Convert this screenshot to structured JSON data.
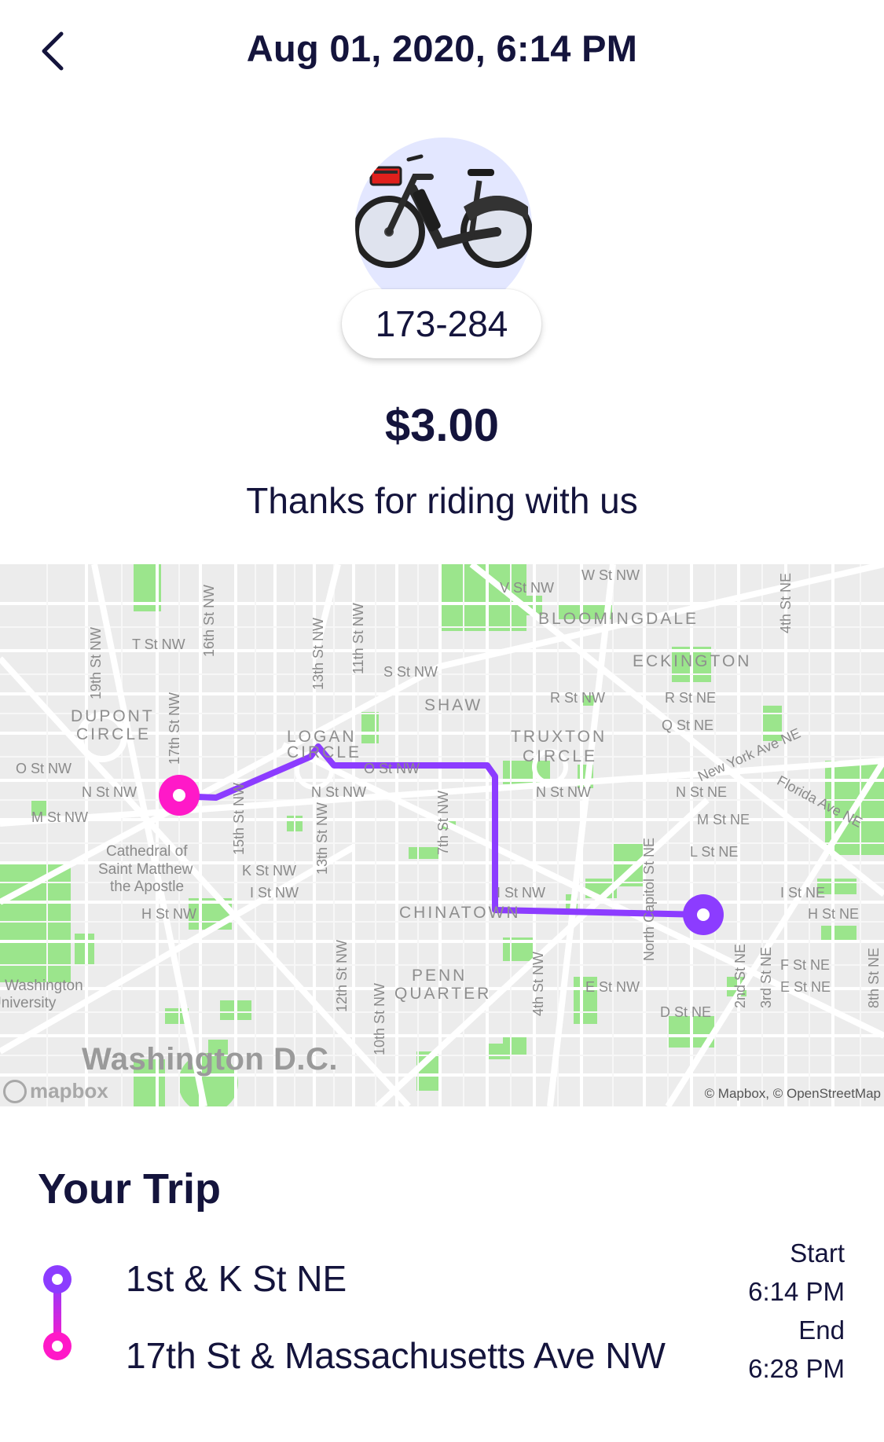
{
  "header": {
    "title": "Aug 01, 2020, 6:14 PM"
  },
  "bike": {
    "id": "173-284"
  },
  "receipt": {
    "price": "$3.00",
    "message": "Thanks for riding with us"
  },
  "map": {
    "districts": [
      "BLOOMINGDALE",
      "ECKINGTON",
      "SHAW",
      "TRUXTON",
      "CIRCLE",
      "DUPONT",
      "CIRCLE",
      "LOGAN",
      "CIRCLE",
      "CHINATOWN",
      "PENN",
      "QUARTER"
    ],
    "streets": [
      "T St NW",
      "S St NW",
      "R St NW",
      "R St NE",
      "Q St NE",
      "O St NW",
      "O St NW",
      "N St NW",
      "N St NW",
      "N St NW",
      "N St NE",
      "M St NW",
      "M St NE",
      "L St NE",
      "K St NW",
      "I St NW",
      "I St NW",
      "I St NE",
      "H St NW",
      "H St NE",
      "F St NE",
      "E St NE",
      "E St NW",
      "D St NE",
      "W St NW",
      "V St NW",
      "New York Ave NE",
      "Florida Ave NE",
      "19th St NW",
      "17th St NW",
      "16th St NW",
      "15th St NW",
      "13th St NW",
      "13th St NW",
      "12th St NW",
      "11th St NW",
      "10th St NW",
      "7th St NW",
      "4th St NW",
      "North Capitol St NE",
      "2nd St NE",
      "3rd St NE",
      "4th St NE",
      "8th St NE"
    ],
    "places": [
      "Cathedral of",
      "Saint Matthew",
      "the Apostle",
      "Washington",
      "University"
    ],
    "city": "Washington D.C.",
    "logo": "mapbox",
    "attribution": "© Mapbox, © OpenStreetMap",
    "route_color": "#8c3cff",
    "start_marker_color": "#ff19c8",
    "end_marker_color": "#8c3cff"
  },
  "trip": {
    "title": "Your Trip",
    "start_location": "1st & K St NE",
    "end_location": "17th St & Massachusetts Ave NW",
    "start_label": "Start",
    "start_time": "6:14 PM",
    "end_label": "End",
    "end_time": "6:28 PM"
  }
}
